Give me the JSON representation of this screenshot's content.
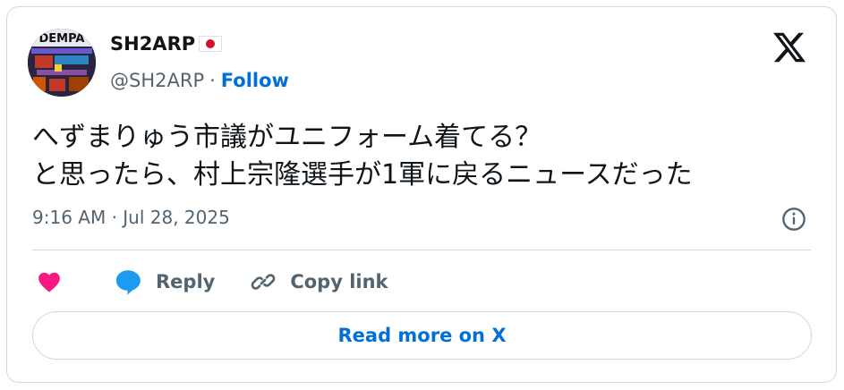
{
  "author": {
    "display_name": "SH2ARP",
    "flag_icon": "japan-flag-icon",
    "handle": "@SH2ARP",
    "separator": "·",
    "follow_label": "Follow",
    "avatar_text": "DEMPA"
  },
  "tweet": {
    "text_line1": "へずまりゅう市議がユニフォーム着てる？",
    "text_line2": "と思ったら、村上宗隆選手が1軍に戻るニュースだった",
    "timestamp": "9:16 AM · Jul 28, 2025"
  },
  "actions": {
    "like_icon": "heart-icon",
    "reply_label": "Reply",
    "copy_link_label": "Copy link"
  },
  "read_more_label": "Read more on X",
  "colors": {
    "accent": "#006fd6",
    "like": "#f91880",
    "reply": "#1d9bf0",
    "muted": "#536471",
    "border": "#cfd9de"
  }
}
